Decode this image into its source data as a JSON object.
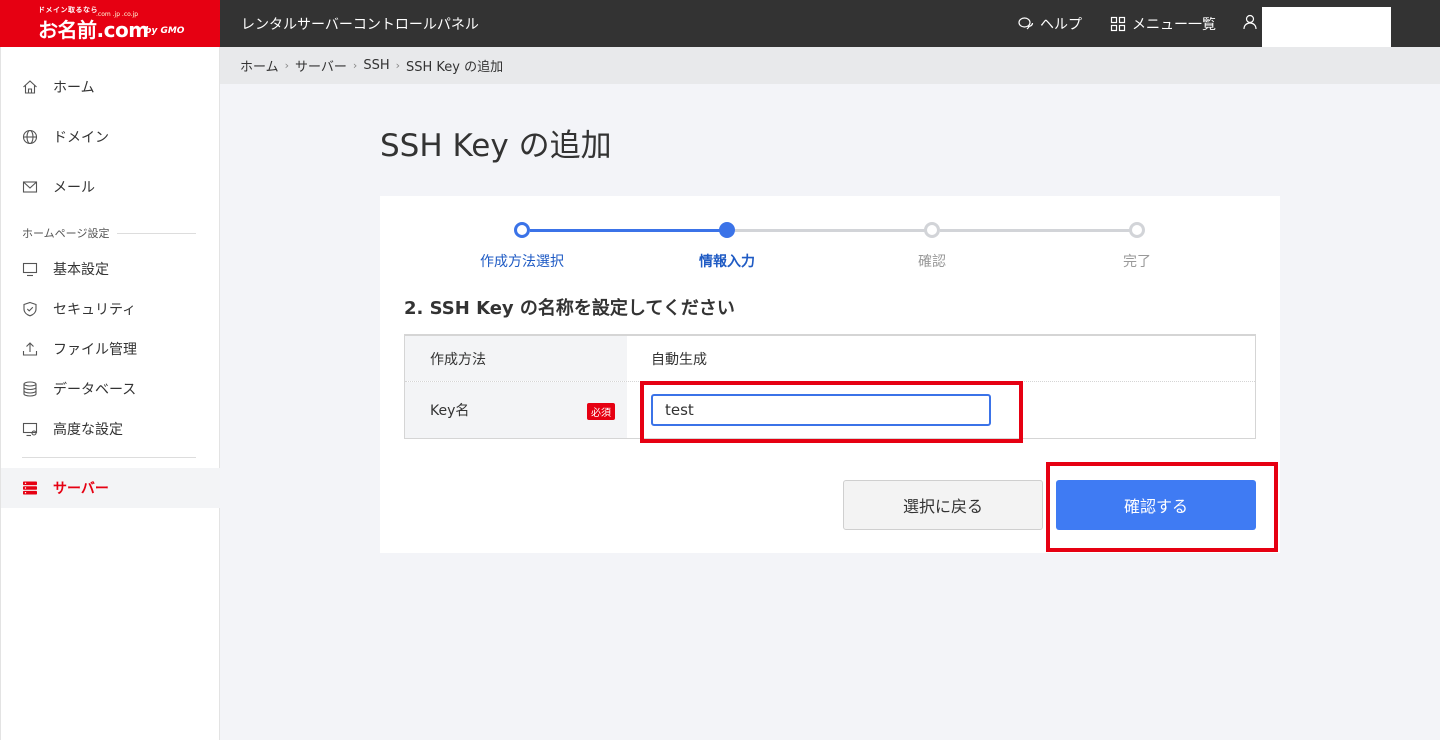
{
  "header": {
    "logo_tagline": "ドメイン取るなら",
    "logo_text": "お名前.com",
    "logo_sub": ".com .jp .co.jp",
    "logo_gmo": "by GMO",
    "app_title": "レンタルサーバーコントロールパネル",
    "help_label": "ヘルプ",
    "menu_label": "メニュー一覧"
  },
  "sidebar": {
    "items": [
      {
        "label": "ホーム",
        "icon": "home-icon"
      },
      {
        "label": "ドメイン",
        "icon": "globe-icon"
      },
      {
        "label": "メール",
        "icon": "mail-icon"
      }
    ],
    "section_label": "ホームページ設定",
    "section_items": [
      {
        "label": "基本設定",
        "icon": "monitor-icon"
      },
      {
        "label": "セキュリティ",
        "icon": "shield-icon"
      },
      {
        "label": "ファイル管理",
        "icon": "upload-icon"
      },
      {
        "label": "データベース",
        "icon": "database-icon"
      },
      {
        "label": "高度な設定",
        "icon": "settings-monitor-icon"
      }
    ],
    "active_item": {
      "label": "サーバー",
      "icon": "server-icon"
    }
  },
  "breadcrumb": [
    "ホーム",
    "サーバー",
    "SSH",
    "SSH Key の追加"
  ],
  "page_title": "SSH Key の追加",
  "stepper": {
    "steps": [
      "作成方法選択",
      "情報入力",
      "確認",
      "完了"
    ],
    "current": 2
  },
  "section_title": "2. SSH Key の名称を設定してください",
  "form": {
    "method_label": "作成方法",
    "method_value": "自動生成",
    "key_label": "Key名",
    "required_badge": "必須",
    "key_value": "test"
  },
  "buttons": {
    "back": "選択に戻る",
    "confirm": "確認する"
  },
  "colors": {
    "brand_red": "#e60012",
    "accent_blue": "#3f7bf3",
    "topbar": "#333333"
  }
}
